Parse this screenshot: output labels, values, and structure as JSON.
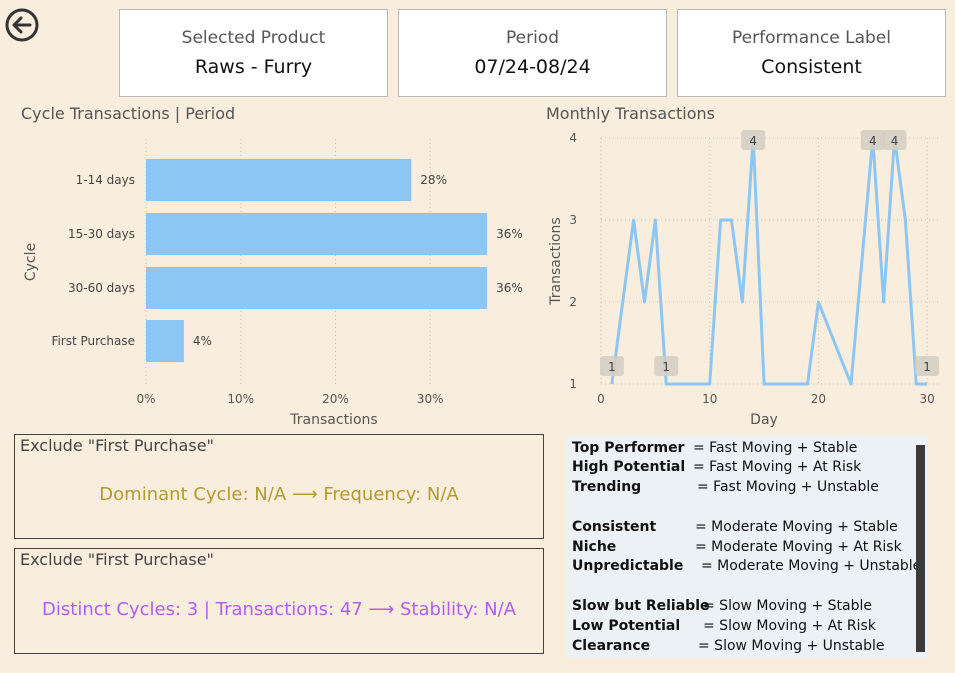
{
  "cards": [
    {
      "label": "Selected Product",
      "value": "Raws - Furry"
    },
    {
      "label": "Period",
      "value": "07/24-08/24"
    },
    {
      "label": "Performance Label",
      "value": "Consistent"
    }
  ],
  "bar_chart_title": "Cycle Transactions | Period",
  "line_chart_title": "Monthly Transactions",
  "chart_data": [
    {
      "type": "bar",
      "orientation": "horizontal",
      "title": "Cycle Transactions | Period",
      "categories": [
        "1-14 days",
        "15-30 days",
        "30-60 days",
        "First Purchase"
      ],
      "values": [
        28,
        36,
        36,
        4
      ],
      "data_labels": [
        "28%",
        "36%",
        "36%",
        "4%"
      ],
      "xlabel": "Transactions",
      "ylabel": "Cycle",
      "xticks": [
        "0%",
        "10%",
        "20%",
        "30%"
      ],
      "xlim": [
        0,
        40
      ],
      "grid": "vertical dotted",
      "color": "#8cc6f4"
    },
    {
      "type": "line",
      "title": "Monthly Transactions",
      "xlabel": "Day",
      "ylabel": "Transactions",
      "x": [
        1,
        3,
        4,
        5,
        6,
        10,
        11,
        12,
        13,
        14,
        15,
        19,
        20,
        23,
        25,
        26,
        27,
        28,
        29,
        30
      ],
      "y": [
        1,
        3,
        2,
        3,
        1,
        1,
        3,
        3,
        2,
        4,
        1,
        1,
        2,
        1,
        4,
        2,
        4,
        3,
        1,
        1
      ],
      "xticks": [
        0,
        10,
        20,
        30
      ],
      "yticks": [
        1,
        2,
        3,
        4
      ],
      "xlim": [
        0,
        31
      ],
      "ylim": [
        1,
        4
      ],
      "point_labels": [
        {
          "x": 1,
          "y": 1,
          "text": "1"
        },
        {
          "x": 6,
          "y": 1,
          "text": "1"
        },
        {
          "x": 14,
          "y": 4,
          "text": "4"
        },
        {
          "x": 25,
          "y": 4,
          "text": "4"
        },
        {
          "x": 27,
          "y": 4,
          "text": "4"
        },
        {
          "x": 30,
          "y": 1,
          "text": "1"
        }
      ],
      "grid": "dotted",
      "color": "#8cc6f4"
    }
  ],
  "notes": [
    {
      "header": "Exclude \"First Purchase\"",
      "message": "Dominant Cycle: N/A ⟶ Frequency: N/A",
      "color": "#b39a2e"
    },
    {
      "header": "Exclude \"First Purchase\"",
      "message": "Distinct Cycles: 3 | Transactions: 47 ⟶ Stability: N/A",
      "color": "#b05ef0"
    }
  ],
  "legend": [
    {
      "term": "Top Performer",
      "def": "= Fast Moving + Stable"
    },
    {
      "term": "High Potential",
      "def": "= Fast Moving + At Risk"
    },
    {
      "term": "Trending",
      "def": "= Fast Moving + Unstable"
    },
    {
      "term": "Consistent",
      "def": "= Moderate Moving + Stable"
    },
    {
      "term": "Niche",
      "def": "= Moderate Moving + At Risk"
    },
    {
      "term": "Unpredictable",
      "def": "= Moderate Moving + Unstable"
    },
    {
      "term": "Slow but Reliable",
      "def": "= Slow Moving + Stable"
    },
    {
      "term": "Low Potential",
      "def": "= Slow Moving + At Risk"
    },
    {
      "term": "Clearance",
      "def": "= Slow Moving + Unstable"
    }
  ]
}
